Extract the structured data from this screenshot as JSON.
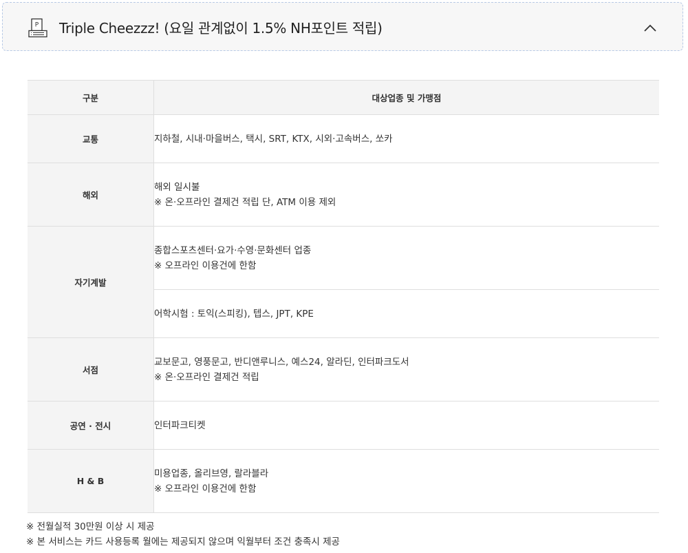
{
  "header": {
    "title": "Triple Cheezzz! (요일 관계없이 1.5% NH포인트 적립)",
    "icon": "point-receipt-icon",
    "toggle_icon": "chevron-up-icon"
  },
  "table": {
    "headers": {
      "category": "구분",
      "merchants": "대상업종 및 가맹점"
    },
    "rows": [
      {
        "category": "교통",
        "lines": [
          "지하철, 시내·마을버스, 택시, SRT, KTX, 시외·고속버스, 쏘카"
        ]
      },
      {
        "category": "해외",
        "lines": [
          "해외 일시불",
          "※ 온·오프라인 결제건 적립 단, ATM 이용 제외"
        ]
      },
      {
        "category": "자기계발",
        "subrows": [
          {
            "lines": [
              "종합스포츠센터·요가·수영·문화센터 업종",
              "※ 오프라인 이용건에 한함"
            ]
          },
          {
            "lines": [
              "어학시험 : 토익(스피킹), 텝스, JPT, KPE"
            ]
          }
        ]
      },
      {
        "category": "서점",
        "lines": [
          "교보문고, 영풍문고, 반디앤루니스, 예스24, 알라딘, 인터파크도서",
          "※ 온·오프라인 결제건 적립"
        ]
      },
      {
        "category": "공연 · 전시",
        "lines": [
          "인터파크티켓"
        ]
      },
      {
        "category": "H & B",
        "lines": [
          "미용업종, 올리브영, 랄라블라",
          "※ 오프라인 이용건에 한함"
        ]
      }
    ]
  },
  "footnotes": [
    "※ 전월실적 30만원 이상 시 제공",
    "※ 본 서비스는 카드 사용등록 월에는 제공되지 않으며 익월부터 조건 충족시 제공"
  ]
}
